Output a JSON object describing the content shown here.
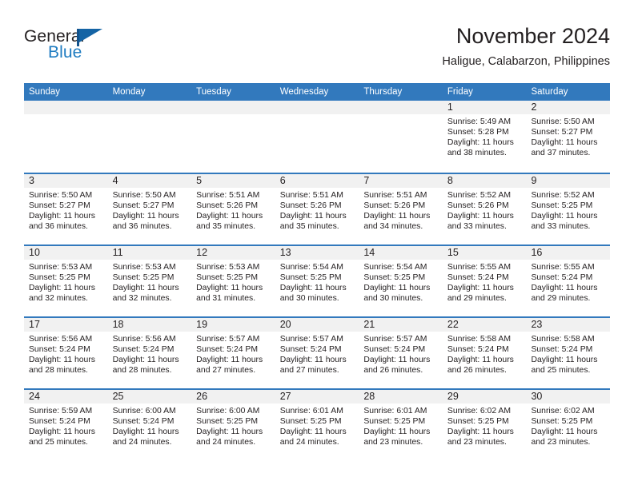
{
  "brand": {
    "word1": "General",
    "word2": "Blue",
    "flag_icon": "blue-flag-triangle-logo",
    "accent_color": "#1f7cc1"
  },
  "header": {
    "month_title": "November 2024",
    "location": "Haligue, Calabarzon, Philippines"
  },
  "theme": {
    "header_blue": "#3279bd",
    "date_band_gray": "#f1f1f1",
    "text_color": "#231f20"
  },
  "calendar": {
    "weekdays": [
      "Sunday",
      "Monday",
      "Tuesday",
      "Wednesday",
      "Thursday",
      "Friday",
      "Saturday"
    ],
    "weeks": [
      [
        {
          "day": "",
          "empty": true
        },
        {
          "day": "",
          "empty": true
        },
        {
          "day": "",
          "empty": true
        },
        {
          "day": "",
          "empty": true
        },
        {
          "day": "",
          "empty": true
        },
        {
          "day": "1",
          "sunrise": "Sunrise: 5:49 AM",
          "sunset": "Sunset: 5:28 PM",
          "daylight1": "Daylight: 11 hours",
          "daylight2": "and 38 minutes."
        },
        {
          "day": "2",
          "sunrise": "Sunrise: 5:50 AM",
          "sunset": "Sunset: 5:27 PM",
          "daylight1": "Daylight: 11 hours",
          "daylight2": "and 37 minutes."
        }
      ],
      [
        {
          "day": "3",
          "sunrise": "Sunrise: 5:50 AM",
          "sunset": "Sunset: 5:27 PM",
          "daylight1": "Daylight: 11 hours",
          "daylight2": "and 36 minutes."
        },
        {
          "day": "4",
          "sunrise": "Sunrise: 5:50 AM",
          "sunset": "Sunset: 5:27 PM",
          "daylight1": "Daylight: 11 hours",
          "daylight2": "and 36 minutes."
        },
        {
          "day": "5",
          "sunrise": "Sunrise: 5:51 AM",
          "sunset": "Sunset: 5:26 PM",
          "daylight1": "Daylight: 11 hours",
          "daylight2": "and 35 minutes."
        },
        {
          "day": "6",
          "sunrise": "Sunrise: 5:51 AM",
          "sunset": "Sunset: 5:26 PM",
          "daylight1": "Daylight: 11 hours",
          "daylight2": "and 35 minutes."
        },
        {
          "day": "7",
          "sunrise": "Sunrise: 5:51 AM",
          "sunset": "Sunset: 5:26 PM",
          "daylight1": "Daylight: 11 hours",
          "daylight2": "and 34 minutes."
        },
        {
          "day": "8",
          "sunrise": "Sunrise: 5:52 AM",
          "sunset": "Sunset: 5:26 PM",
          "daylight1": "Daylight: 11 hours",
          "daylight2": "and 33 minutes."
        },
        {
          "day": "9",
          "sunrise": "Sunrise: 5:52 AM",
          "sunset": "Sunset: 5:25 PM",
          "daylight1": "Daylight: 11 hours",
          "daylight2": "and 33 minutes."
        }
      ],
      [
        {
          "day": "10",
          "sunrise": "Sunrise: 5:53 AM",
          "sunset": "Sunset: 5:25 PM",
          "daylight1": "Daylight: 11 hours",
          "daylight2": "and 32 minutes."
        },
        {
          "day": "11",
          "sunrise": "Sunrise: 5:53 AM",
          "sunset": "Sunset: 5:25 PM",
          "daylight1": "Daylight: 11 hours",
          "daylight2": "and 32 minutes."
        },
        {
          "day": "12",
          "sunrise": "Sunrise: 5:53 AM",
          "sunset": "Sunset: 5:25 PM",
          "daylight1": "Daylight: 11 hours",
          "daylight2": "and 31 minutes."
        },
        {
          "day": "13",
          "sunrise": "Sunrise: 5:54 AM",
          "sunset": "Sunset: 5:25 PM",
          "daylight1": "Daylight: 11 hours",
          "daylight2": "and 30 minutes."
        },
        {
          "day": "14",
          "sunrise": "Sunrise: 5:54 AM",
          "sunset": "Sunset: 5:25 PM",
          "daylight1": "Daylight: 11 hours",
          "daylight2": "and 30 minutes."
        },
        {
          "day": "15",
          "sunrise": "Sunrise: 5:55 AM",
          "sunset": "Sunset: 5:24 PM",
          "daylight1": "Daylight: 11 hours",
          "daylight2": "and 29 minutes."
        },
        {
          "day": "16",
          "sunrise": "Sunrise: 5:55 AM",
          "sunset": "Sunset: 5:24 PM",
          "daylight1": "Daylight: 11 hours",
          "daylight2": "and 29 minutes."
        }
      ],
      [
        {
          "day": "17",
          "sunrise": "Sunrise: 5:56 AM",
          "sunset": "Sunset: 5:24 PM",
          "daylight1": "Daylight: 11 hours",
          "daylight2": "and 28 minutes."
        },
        {
          "day": "18",
          "sunrise": "Sunrise: 5:56 AM",
          "sunset": "Sunset: 5:24 PM",
          "daylight1": "Daylight: 11 hours",
          "daylight2": "and 28 minutes."
        },
        {
          "day": "19",
          "sunrise": "Sunrise: 5:57 AM",
          "sunset": "Sunset: 5:24 PM",
          "daylight1": "Daylight: 11 hours",
          "daylight2": "and 27 minutes."
        },
        {
          "day": "20",
          "sunrise": "Sunrise: 5:57 AM",
          "sunset": "Sunset: 5:24 PM",
          "daylight1": "Daylight: 11 hours",
          "daylight2": "and 27 minutes."
        },
        {
          "day": "21",
          "sunrise": "Sunrise: 5:57 AM",
          "sunset": "Sunset: 5:24 PM",
          "daylight1": "Daylight: 11 hours",
          "daylight2": "and 26 minutes."
        },
        {
          "day": "22",
          "sunrise": "Sunrise: 5:58 AM",
          "sunset": "Sunset: 5:24 PM",
          "daylight1": "Daylight: 11 hours",
          "daylight2": "and 26 minutes."
        },
        {
          "day": "23",
          "sunrise": "Sunrise: 5:58 AM",
          "sunset": "Sunset: 5:24 PM",
          "daylight1": "Daylight: 11 hours",
          "daylight2": "and 25 minutes."
        }
      ],
      [
        {
          "day": "24",
          "sunrise": "Sunrise: 5:59 AM",
          "sunset": "Sunset: 5:24 PM",
          "daylight1": "Daylight: 11 hours",
          "daylight2": "and 25 minutes."
        },
        {
          "day": "25",
          "sunrise": "Sunrise: 6:00 AM",
          "sunset": "Sunset: 5:24 PM",
          "daylight1": "Daylight: 11 hours",
          "daylight2": "and 24 minutes."
        },
        {
          "day": "26",
          "sunrise": "Sunrise: 6:00 AM",
          "sunset": "Sunset: 5:25 PM",
          "daylight1": "Daylight: 11 hours",
          "daylight2": "and 24 minutes."
        },
        {
          "day": "27",
          "sunrise": "Sunrise: 6:01 AM",
          "sunset": "Sunset: 5:25 PM",
          "daylight1": "Daylight: 11 hours",
          "daylight2": "and 24 minutes."
        },
        {
          "day": "28",
          "sunrise": "Sunrise: 6:01 AM",
          "sunset": "Sunset: 5:25 PM",
          "daylight1": "Daylight: 11 hours",
          "daylight2": "and 23 minutes."
        },
        {
          "day": "29",
          "sunrise": "Sunrise: 6:02 AM",
          "sunset": "Sunset: 5:25 PM",
          "daylight1": "Daylight: 11 hours",
          "daylight2": "and 23 minutes."
        },
        {
          "day": "30",
          "sunrise": "Sunrise: 6:02 AM",
          "sunset": "Sunset: 5:25 PM",
          "daylight1": "Daylight: 11 hours",
          "daylight2": "and 23 minutes."
        }
      ]
    ]
  }
}
